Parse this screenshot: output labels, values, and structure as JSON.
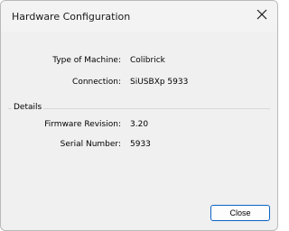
{
  "window": {
    "title": "Hardware Configuration"
  },
  "machine": {
    "type_label": "Type of Machine:",
    "type_value": "Colibrick",
    "connection_label": "Connection:",
    "connection_value": "SiUSBXp 5933"
  },
  "details": {
    "group_label": "Details",
    "firmware_label": "Firmware Revision:",
    "firmware_value": "3.20",
    "serial_label": "Serial Number:",
    "serial_value": "5933"
  },
  "buttons": {
    "close_label": "Close"
  },
  "icons": {
    "close": "close-icon"
  },
  "colors": {
    "dialog_bg": "#f0f0f0",
    "button_border": "#0b62c5"
  }
}
